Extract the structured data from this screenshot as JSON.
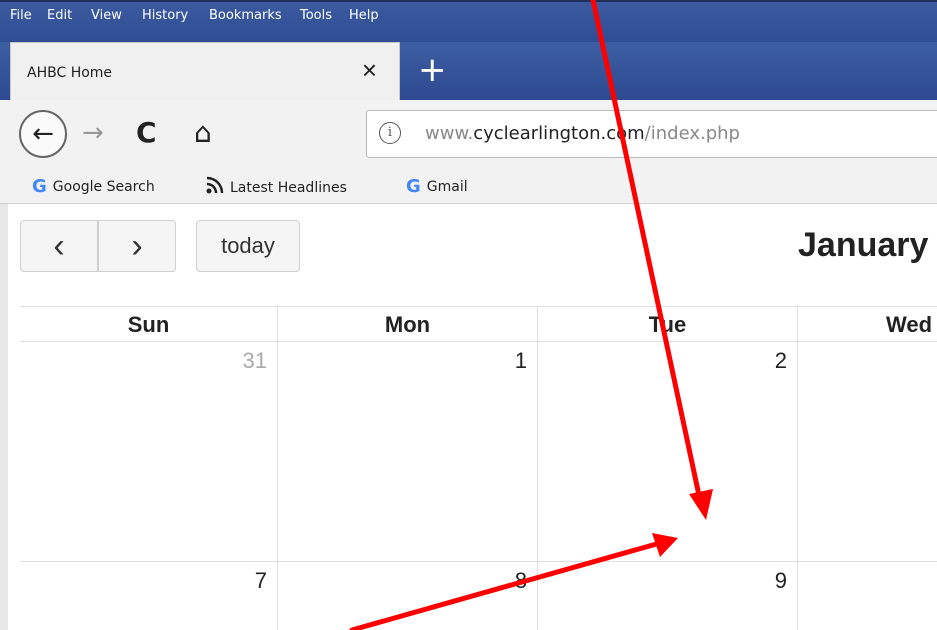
{
  "menu": [
    "File",
    "Edit",
    "View",
    "History",
    "Bookmarks",
    "Tools",
    "Help"
  ],
  "tab": {
    "title": "AHBC Home",
    "close": "×",
    "new_tab": "+"
  },
  "nav": {
    "back": "←",
    "forward": "→",
    "reload": "C",
    "home": "⌂"
  },
  "url": {
    "info": "i",
    "prefix": "www.",
    "domain": "cyclearlington.com",
    "path": "/index.php"
  },
  "bookmarks": [
    {
      "icon": "G",
      "label": "Google Search"
    },
    {
      "icon": "rss",
      "label": "Latest Headlines"
    },
    {
      "icon": "G",
      "label": "Gmail"
    }
  ],
  "calendar": {
    "prev": "‹",
    "next": "›",
    "today": "today",
    "title": "January",
    "days_of_week": [
      "Sun",
      "Mon",
      "Tue",
      "Wed"
    ],
    "weeks": [
      [
        "31",
        "1",
        "2",
        ""
      ],
      [
        "7",
        "8",
        "9",
        ""
      ]
    ]
  },
  "colors": {
    "menu_bg": "#2f4d93",
    "annotation": "#ff0000"
  }
}
